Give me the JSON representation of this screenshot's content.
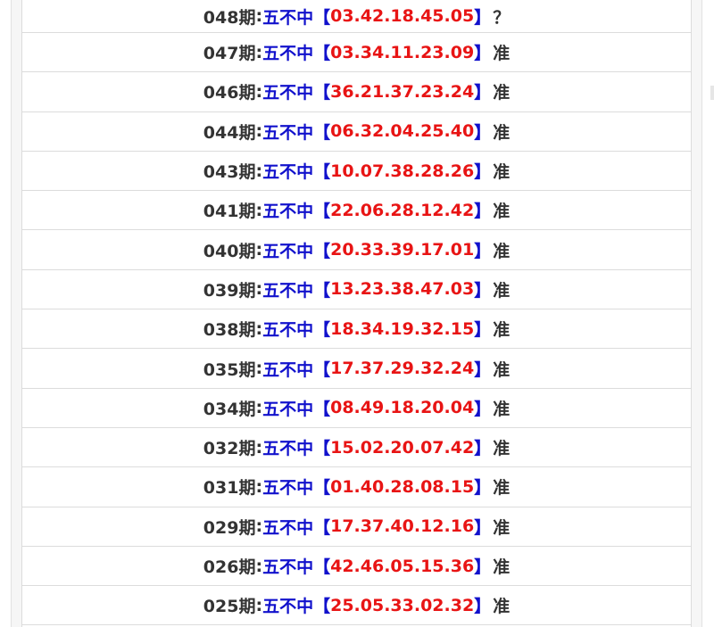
{
  "list": {
    "rows": [
      {
        "issue": "048期",
        "label": "五不中",
        "numbers": "03.42.18.45.05",
        "result": "？"
      },
      {
        "issue": "047期",
        "label": "五不中",
        "numbers": "03.34.11.23.09",
        "result": "准"
      },
      {
        "issue": "046期",
        "label": "五不中",
        "numbers": "36.21.37.23.24",
        "result": "准"
      },
      {
        "issue": "044期",
        "label": "五不中",
        "numbers": "06.32.04.25.40",
        "result": "准"
      },
      {
        "issue": "043期",
        "label": "五不中",
        "numbers": "10.07.38.28.26",
        "result": "准"
      },
      {
        "issue": "041期",
        "label": "五不中",
        "numbers": "22.06.28.12.42",
        "result": "准"
      },
      {
        "issue": "040期",
        "label": "五不中",
        "numbers": "20.33.39.17.01",
        "result": "准"
      },
      {
        "issue": "039期",
        "label": "五不中",
        "numbers": "13.23.38.47.03",
        "result": "准"
      },
      {
        "issue": "038期",
        "label": "五不中",
        "numbers": "18.34.19.32.15",
        "result": "准"
      },
      {
        "issue": "035期",
        "label": "五不中",
        "numbers": "17.37.29.32.24",
        "result": "准"
      },
      {
        "issue": "034期",
        "label": "五不中",
        "numbers": "08.49.18.20.04",
        "result": "准"
      },
      {
        "issue": "032期",
        "label": "五不中",
        "numbers": "15.02.20.07.42",
        "result": "准"
      },
      {
        "issue": "031期",
        "label": "五不中",
        "numbers": "01.40.28.08.15",
        "result": "准"
      },
      {
        "issue": "029期",
        "label": "五不中",
        "numbers": "17.37.40.12.16",
        "result": "准"
      },
      {
        "issue": "026期",
        "label": "五不中",
        "numbers": "42.46.05.15.36",
        "result": "准"
      },
      {
        "issue": "025期",
        "label": "五不中",
        "numbers": "25.05.33.02.32",
        "result": "准"
      }
    ]
  },
  "colors": {
    "issue": "#333333",
    "label": "#1111cc",
    "numbers": "#e81414",
    "divider": "#dcdcdc"
  }
}
